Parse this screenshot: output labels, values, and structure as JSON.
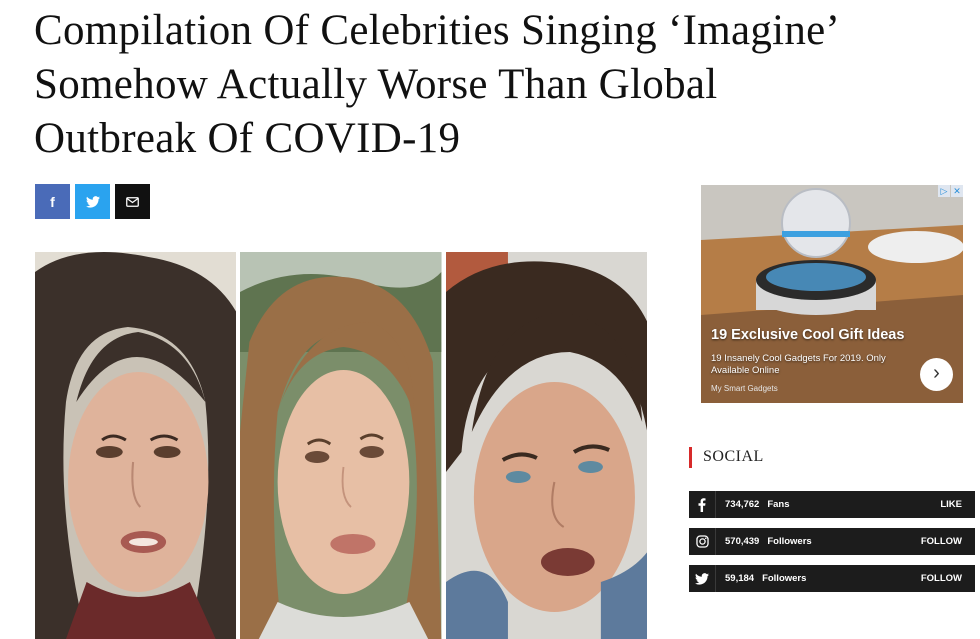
{
  "article": {
    "headline_line1": "Compilation Of Celebrities Singing ‘Imagine’",
    "headline_line2": "Somehow Actually Worse Than Global",
    "headline_line3": "Outbreak Of COVID-19"
  },
  "share_buttons": [
    {
      "icon": "facebook-icon",
      "glyph": "f",
      "color": "#4a6bb8"
    },
    {
      "icon": "twitter-icon",
      "color": "#2aa3ef"
    },
    {
      "icon": "email-icon",
      "color": "#111111"
    }
  ],
  "ad": {
    "choices_icons": [
      "ad-choices-icon",
      "close-icon"
    ],
    "title": "19 Exclusive Cool Gift Ideas",
    "description": "19 Insanely Cool Gadgets For 2019. Only Available Online",
    "source": "My Smart Gadgets",
    "arrow": "›"
  },
  "sidebar": {
    "social_heading": "SOCIAL",
    "social": [
      {
        "icon": "facebook-icon",
        "count": "734,762",
        "unit": "Fans",
        "action": "LIKE"
      },
      {
        "icon": "instagram-icon",
        "count": "570,439",
        "unit": "Followers",
        "action": "FOLLOW"
      },
      {
        "icon": "twitter-icon",
        "count": "59,184",
        "unit": "Followers",
        "action": "FOLLOW"
      }
    ]
  },
  "colors": {
    "accent_red": "#d72a2a",
    "social_bar": "#1c1c1c",
    "facebook": "#4a6bb8",
    "twitter": "#2aa3ef"
  }
}
